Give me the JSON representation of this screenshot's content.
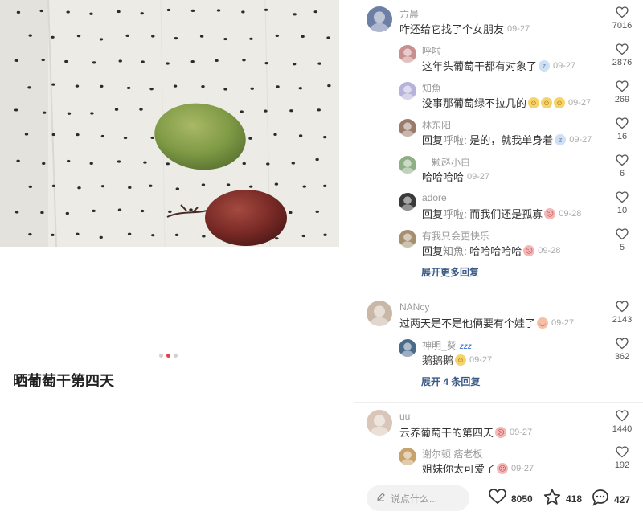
{
  "post": {
    "title": "晒葡萄干第四天",
    "carousel": {
      "count": 3,
      "active": 1
    }
  },
  "comments": [
    {
      "user": "方晨",
      "text": "咋还给它找了个女朋友",
      "date": "09-27",
      "likes": "7016",
      "level": 1
    },
    {
      "user": "呼啦",
      "text": "这年头葡萄干都有对象了",
      "emojis": [
        "sleep-emoji"
      ],
      "date": "09-27",
      "likes": "2876",
      "level": 2
    },
    {
      "user": "知魚",
      "text": "没事那葡萄绿不拉几的",
      "emojis": [
        "grin-emoji",
        "grin-emoji",
        "grin-emoji"
      ],
      "date": "09-27",
      "likes": "269",
      "level": 2
    },
    {
      "user": "林东阳",
      "reply_prefix": "回复",
      "reply_to": "呼啦",
      "text": ": 是的，就我单身着",
      "emojis": [
        "sleep-emoji"
      ],
      "date": "09-27",
      "likes": "16",
      "level": 2
    },
    {
      "user": "一颗赵小白",
      "text": "哈哈哈哈",
      "date": "09-27",
      "likes": "6",
      "level": 2
    },
    {
      "user": "adore",
      "reply_prefix": "回复",
      "reply_to": "呼啦",
      "text": ": 而我们还是孤寡",
      "emojis": [
        "cry-emoji"
      ],
      "date": "09-28",
      "likes": "10",
      "level": 2
    },
    {
      "user": "有我只会更快乐",
      "reply_prefix": "回复",
      "reply_to": "知魚",
      "text": ": 哈哈哈哈哈",
      "emojis": [
        "cry-emoji"
      ],
      "date": "09-28",
      "likes": "5",
      "level": 2
    },
    {
      "user": "NANcy",
      "text": "过两天是不是他俩要有个娃了",
      "emojis": [
        "blush-emoji"
      ],
      "date": "09-27",
      "likes": "2143",
      "level": 1
    },
    {
      "user": "神明_葵",
      "user_suffix": "zzz",
      "text": "鹅鹅鹅",
      "emojis": [
        "grin-emoji"
      ],
      "date": "09-27",
      "likes": "362",
      "level": 2
    },
    {
      "user": "uu",
      "text": "云养葡萄干的第四天",
      "emojis": [
        "cry-emoji"
      ],
      "date": "09-27",
      "likes": "1440",
      "level": 1
    },
    {
      "user": "谢尔顿 痞老板",
      "text": "姐妹你太可爱了",
      "emojis": [
        "cry-emoji"
      ],
      "date": "09-27",
      "likes": "192",
      "level": 2
    }
  ],
  "expand_1": "展开更多回复",
  "expand_2": "展开 4 条回复",
  "bottom_bar": {
    "placeholder": "说点什么...",
    "likes": "8050",
    "favorites": "418",
    "comments": "427"
  },
  "colors": {
    "accent": "#e5404a",
    "link": "#3b5b86"
  }
}
